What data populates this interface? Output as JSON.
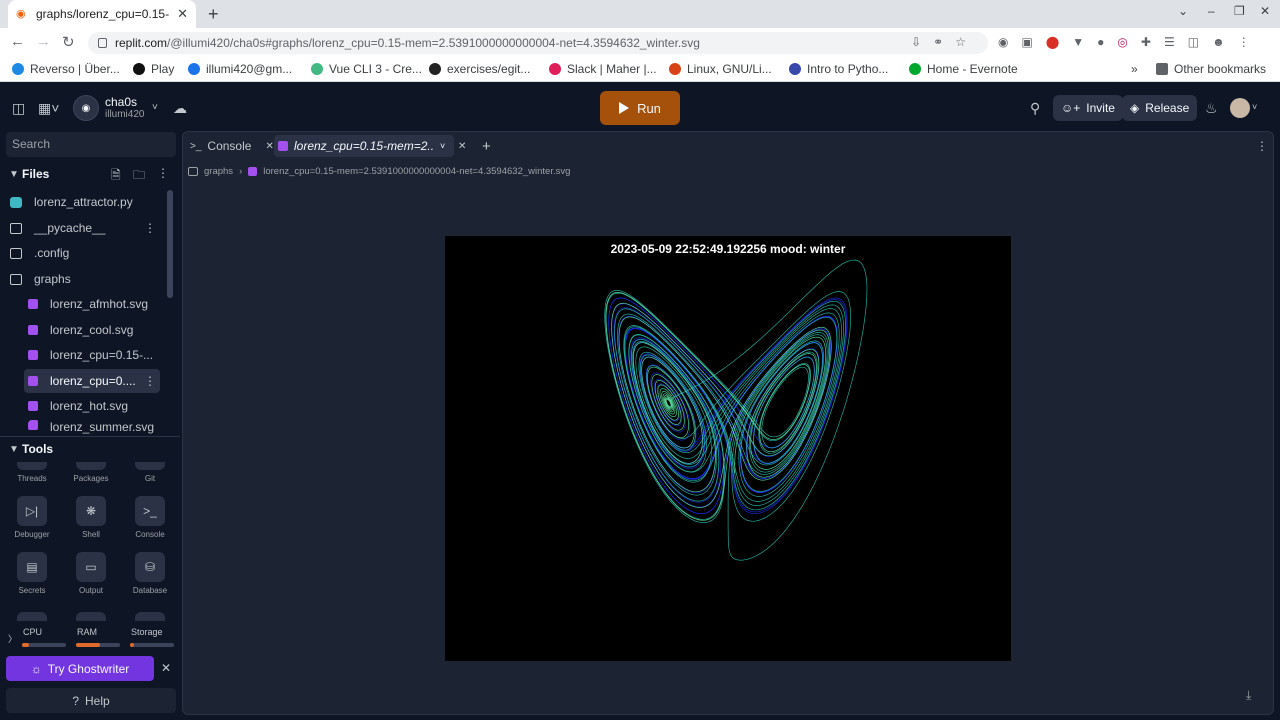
{
  "browser": {
    "tab_title": "graphs/lorenz_cpu=0.15-",
    "url_host": "replit.com",
    "url_path": "/@illumi420/cha0s#graphs/lorenz_cpu=0.15-mem=2.5391000000000004-net=4.3594632_winter.svg",
    "bookmarks": [
      {
        "label": "Reverso | Über...",
        "color": "#1e88e5"
      },
      {
        "label": "Play",
        "color": "#111111"
      },
      {
        "label": "illumi420@gm...",
        "color": "#1a73e8"
      },
      {
        "label": "Vue CLI 3 - Cre...",
        "color": "#42b883"
      },
      {
        "label": "exercises/egit...",
        "color": "#222222"
      },
      {
        "label": "Slack | Maher |...",
        "color": "#e01e5a"
      },
      {
        "label": "Linux, GNU/Li...",
        "color": "#d84315"
      },
      {
        "label": "Intro to Pytho...",
        "color": "#3949ab"
      },
      {
        "label": "Home - Evernote",
        "color": "#00a82d"
      }
    ],
    "other_bookmarks": "Other bookmarks"
  },
  "header": {
    "repl_name": "cha0s",
    "repl_owner": "illumi420",
    "run_label": "Run",
    "invite_label": "Invite",
    "release_label": "Release"
  },
  "sidebar": {
    "search_placeholder": "Search",
    "files_title": "Files",
    "files": [
      {
        "label": "lorenz_attractor.py",
        "type": "py"
      },
      {
        "label": "__pycache__",
        "type": "folder"
      },
      {
        "label": ".config",
        "type": "folder"
      },
      {
        "label": "graphs",
        "type": "folder"
      },
      {
        "label": "lorenz_afmhot.svg",
        "type": "svg"
      },
      {
        "label": "lorenz_cool.svg",
        "type": "svg"
      },
      {
        "label": "lorenz_cpu=0.15-...",
        "type": "svg"
      },
      {
        "label": "lorenz_cpu=0....",
        "type": "svg"
      },
      {
        "label": "lorenz_hot.svg",
        "type": "svg"
      },
      {
        "label": "lorenz_summer.svg",
        "type": "svg"
      }
    ],
    "tools_title": "Tools",
    "tools_row0": [
      "Threads",
      "Packages",
      "Git"
    ],
    "tools_row1": [
      "Debugger",
      "Shell",
      "Console"
    ],
    "tools_row2": [
      "Secrets",
      "Output",
      "Database"
    ],
    "resources": [
      {
        "label": "CPU",
        "fill": 0.15,
        "color": "#e0692c"
      },
      {
        "label": "RAM",
        "fill": 0.55,
        "color": "#e0692c"
      },
      {
        "label": "Storage",
        "fill": 0.1,
        "color": "#e0692c"
      }
    ],
    "ghostwriter_label": "Try Ghostwriter",
    "help_label": "Help"
  },
  "main": {
    "tab_console": "Console",
    "tab_file": "lorenz_cpu=0.15-mem=2....",
    "breadcrumb_folder": "graphs",
    "breadcrumb_file": "lorenz_cpu=0.15-mem=2.5391000000000004-net=4.3594632_winter.svg",
    "plot_title": "2023-05-09 22:52:49.192256 mood: winter"
  }
}
